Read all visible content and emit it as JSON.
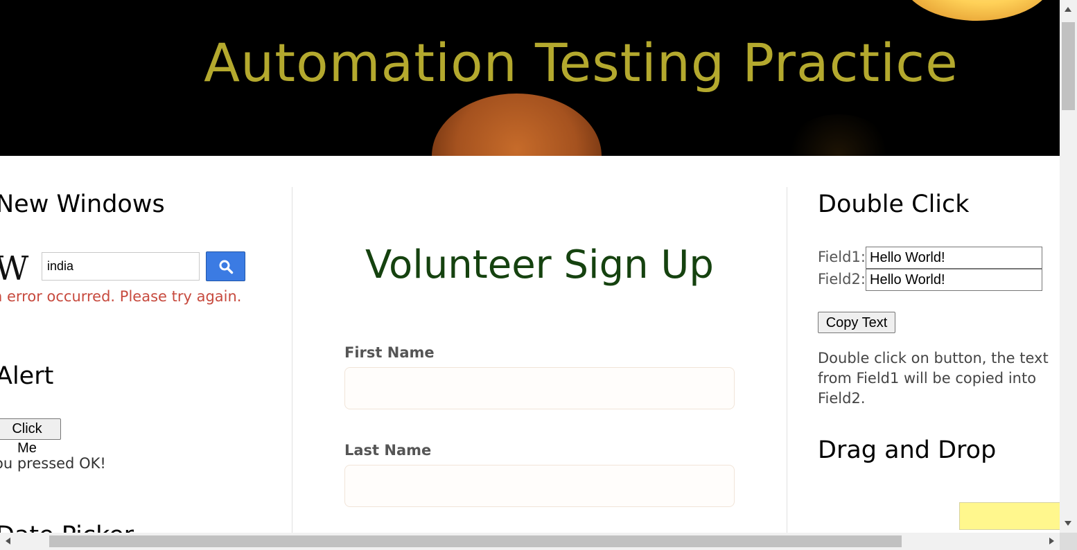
{
  "header": {
    "title": "Automation Testing Practice"
  },
  "left": {
    "new_windows_title": "New Windows",
    "wiki_logo": "W",
    "wiki_search_value": "india",
    "wiki_error": "n error occurred. Please try again.",
    "alert_title": "Alert",
    "click_me_label": "Click Me",
    "alert_result": "ou pressed OK!",
    "date_picker_title_partial": "Date Picker"
  },
  "signup": {
    "title": "Volunteer Sign Up",
    "first_name_label": "First Name",
    "last_name_label": "Last Name"
  },
  "right": {
    "double_click_title": "Double Click",
    "field1_label": "Field1:",
    "field1_value": "Hello World!",
    "field2_label": "Field2:",
    "field2_value": "Hello World!",
    "copy_text_label": "Copy Text",
    "description": "Double click on button, the text from Field1 will be copied into Field2.",
    "drag_drop_title": "Drag and Drop"
  },
  "icons": {
    "search": "search-icon",
    "scroll_up": "arrow-up-icon",
    "scroll_down": "arrow-down-icon",
    "scroll_left": "arrow-left-icon",
    "scroll_right": "arrow-right-icon"
  },
  "colors": {
    "title_gold": "#b4a92e",
    "signup_green": "#15420f",
    "error_red": "#c74a3e",
    "search_blue": "#3b7be3",
    "draggable_yellow": "#fff78d"
  }
}
